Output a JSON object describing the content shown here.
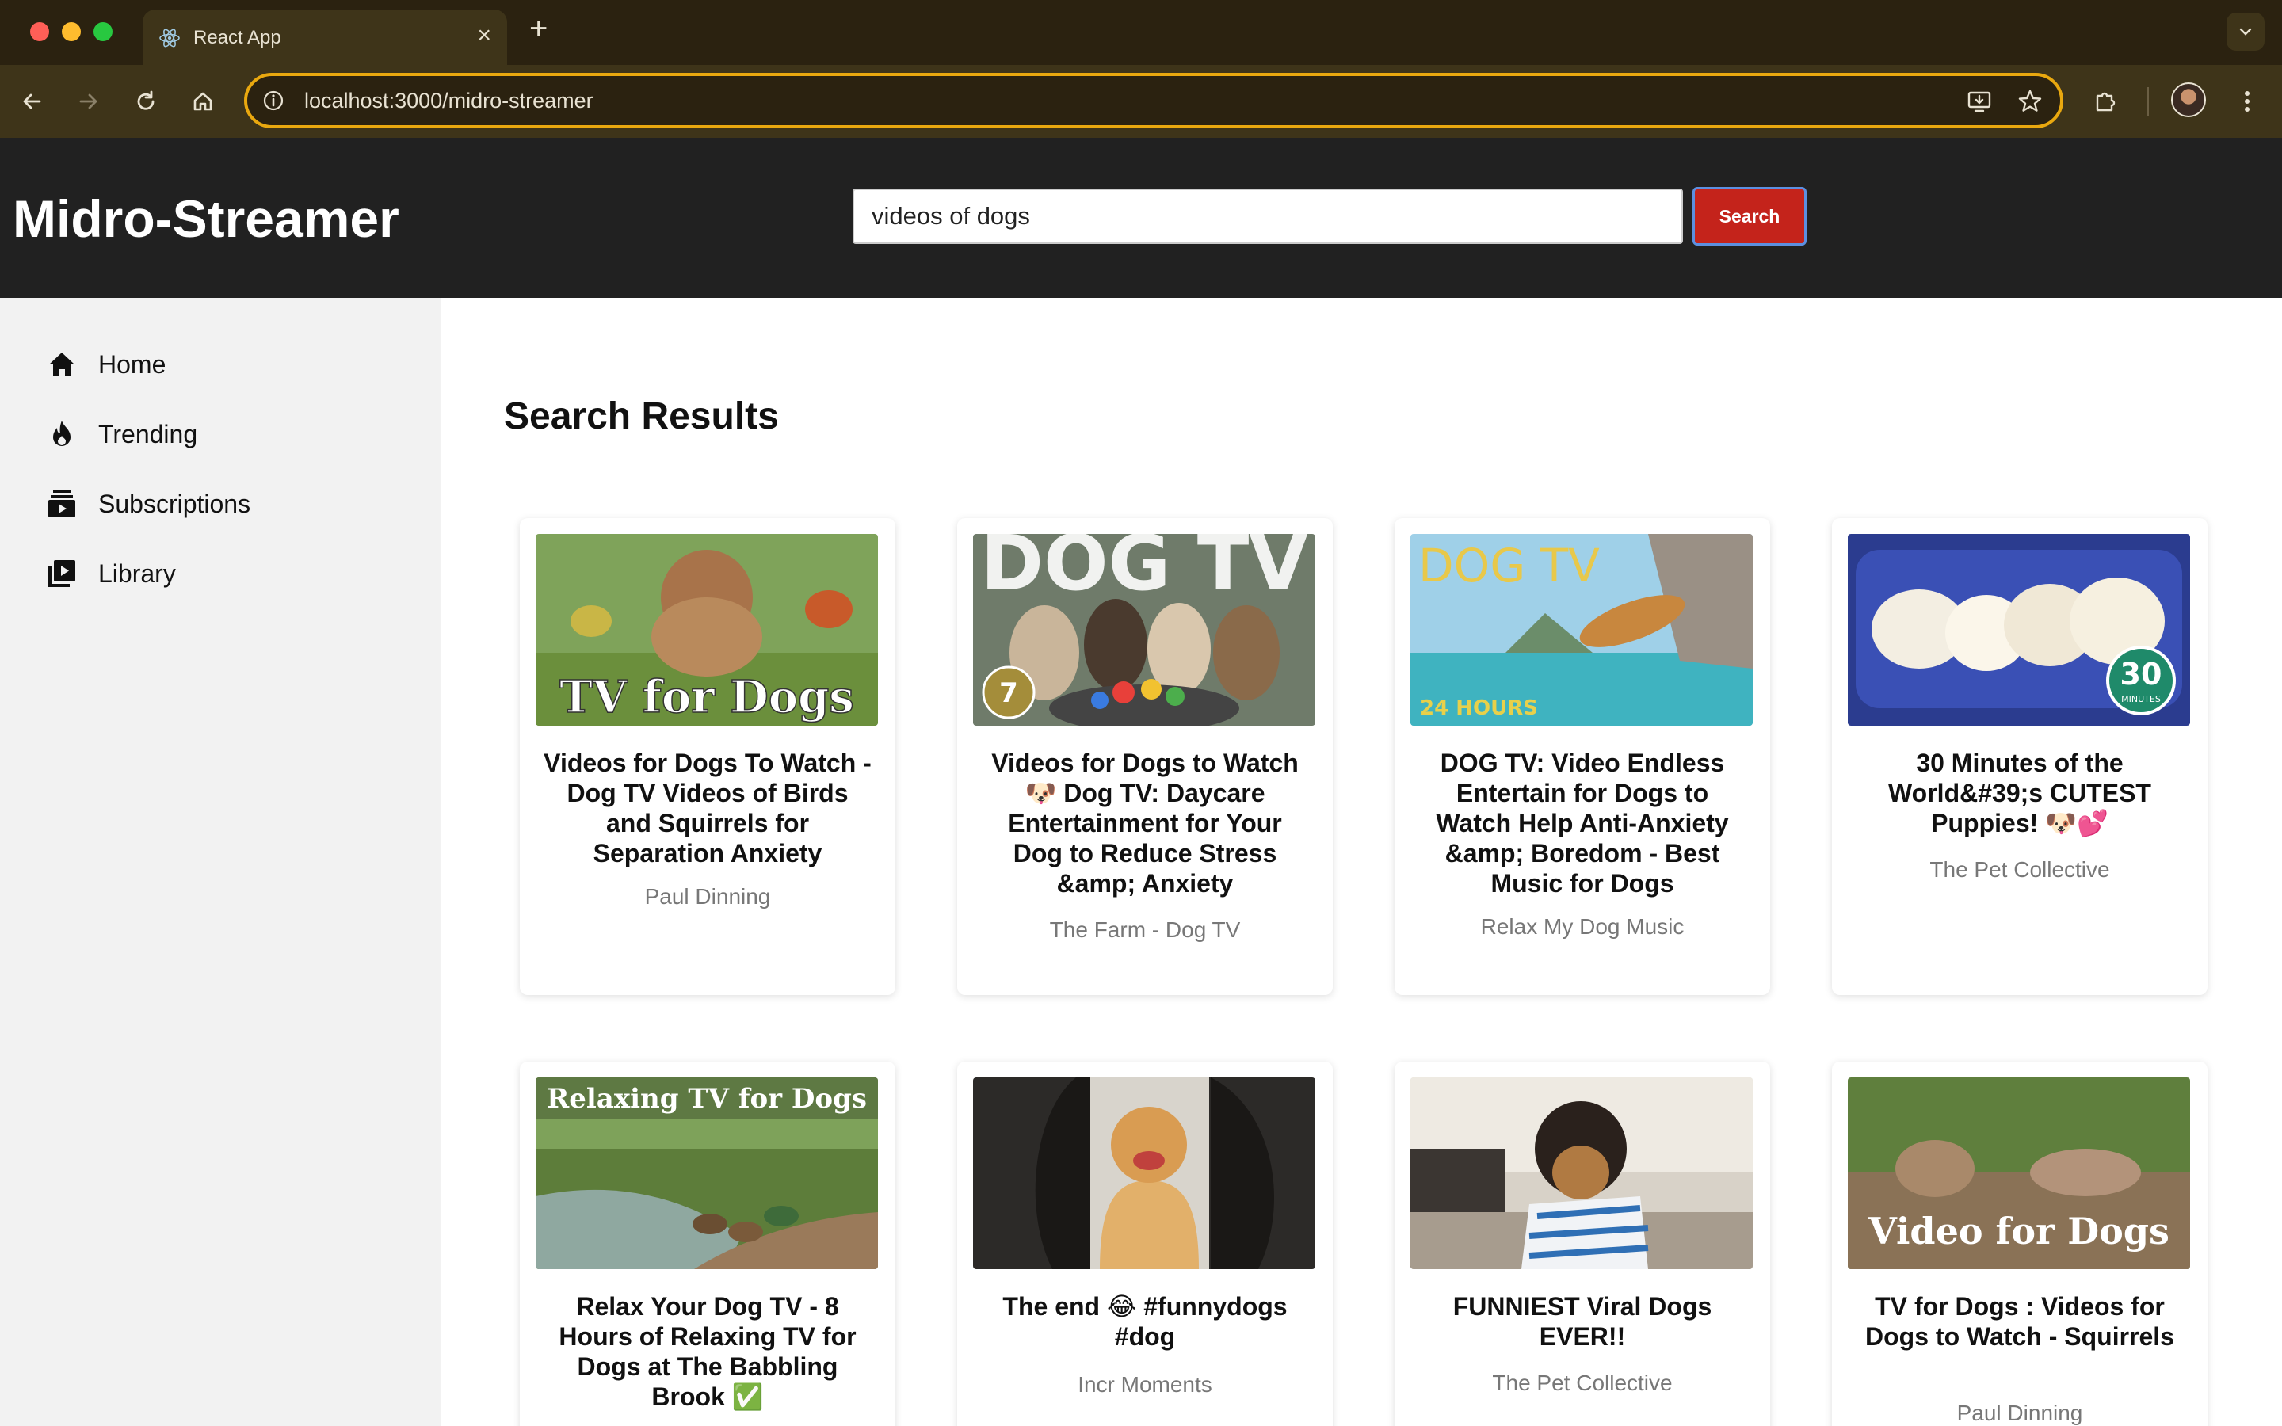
{
  "browser": {
    "tab_title": "React App",
    "url": "localhost:3000/midro-streamer"
  },
  "header": {
    "brand": "Midro-Streamer",
    "search_value": "videos of dogs",
    "search_button": "Search"
  },
  "sidebar": {
    "items": [
      {
        "label": "Home",
        "icon": "home-icon"
      },
      {
        "label": "Trending",
        "icon": "flame-icon"
      },
      {
        "label": "Subscriptions",
        "icon": "subscriptions-icon"
      },
      {
        "label": "Library",
        "icon": "library-icon"
      }
    ]
  },
  "main": {
    "title": "Search Results",
    "videos": [
      {
        "title": "Videos for Dogs To Watch - Dog TV Videos of Birds and Squirrels for Separation Anxiety",
        "channel": "Paul Dinning",
        "thumb_text": "TV for Dogs"
      },
      {
        "title": "Videos for Dogs to Watch 🐶 Dog TV: Daycare Entertainment for Your Dog to Reduce Stress &amp; Anxiety",
        "channel": "The Farm - Dog TV",
        "thumb_text": "DOG TV"
      },
      {
        "title": "DOG TV: Video Endless Entertain for Dogs to Watch Help Anti-Anxiety &amp; Boredom - Best Music for Dogs",
        "channel": "Relax My Dog Music",
        "thumb_text": "DOG TV",
        "thumb_badge": "24 HOURS"
      },
      {
        "title": "30 Minutes of the World&#39;s CUTEST Puppies! 🐶💕",
        "channel": "The Pet Collective",
        "thumb_badge": "30",
        "thumb_badge_sub": "MINUTES"
      },
      {
        "title": "Relax Your Dog TV - 8 Hours of Relaxing TV for Dogs at The Babbling Brook ✅",
        "channel": "",
        "thumb_text": "Relaxing TV for Dogs"
      },
      {
        "title": "The end 😂 #funnydogs #dog",
        "channel": "Incr Moments"
      },
      {
        "title": "FUNNIEST Viral Dogs EVER!!",
        "channel": "The Pet Collective"
      },
      {
        "title": "TV for Dogs : Videos for Dogs to Watch - Squirrels",
        "channel": "Paul Dinning",
        "thumb_text": "Video for Dogs"
      }
    ]
  }
}
